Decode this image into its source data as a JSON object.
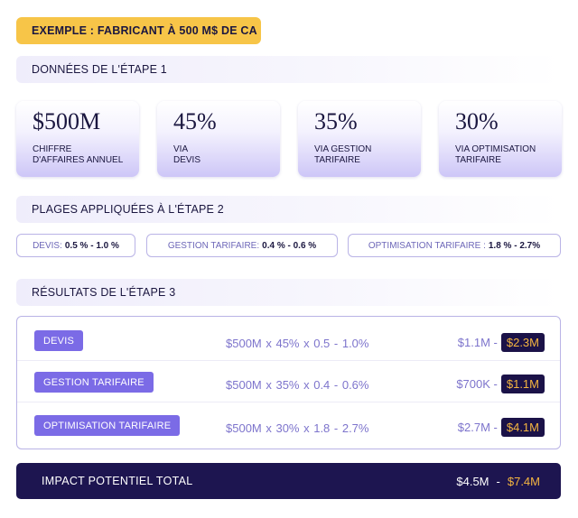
{
  "badge": "EXEMPLE : FABRICANT À 500 M$ DE CA",
  "step1": {
    "title": "DONNÉES DE L'ÉTAPE 1",
    "cards": [
      {
        "value": "$500M",
        "caption": "CHIFFRE\nD'AFFAIRES ANNUEL"
      },
      {
        "value": "45%",
        "caption": "VIA\nDEVIS"
      },
      {
        "value": "35%",
        "caption": "VIA GESTION\nTARIFAIRE"
      },
      {
        "value": "30%",
        "caption": "VIA OPTIMISATION\nTARIFAIRE"
      }
    ]
  },
  "step2": {
    "title": "PLAGES APPLIQUÉES À L'ÉTAPE 2",
    "ranges": [
      {
        "label": "DEVIS:",
        "value": "0.5 % - 1.0 %"
      },
      {
        "label": "GESTION TARIFAIRE:",
        "value": "0.4 % - 0.6 %"
      },
      {
        "label": "OPTIMISATION TARIFAIRE :",
        "value": "1.8 % - 2.7%"
      }
    ]
  },
  "step3": {
    "title": "RÉSULTATS DE L'ÉTAPE 3",
    "rows": [
      {
        "tag": "DEVIS",
        "formula": "$500M  x 45%  x  0.5 - 1.0%",
        "low": "$1.1M -",
        "high": "$2.3M"
      },
      {
        "tag": "GESTION TARIFAIRE",
        "formula": "$500M  x 35%  x  0.4 - 0.6%",
        "low": "$700K -",
        "high": "$1.1M"
      },
      {
        "tag": "OPTIMISATION TARIFAIRE",
        "formula": "$500M  x 30%  x  1.8 - 2.7%",
        "low": "$2.7M -",
        "high": "$4.1M"
      }
    ]
  },
  "total": {
    "label": "IMPACT POTENTIEL TOTAL",
    "low": "$4.5M",
    "dash": "-",
    "high": "$7.4M"
  }
}
